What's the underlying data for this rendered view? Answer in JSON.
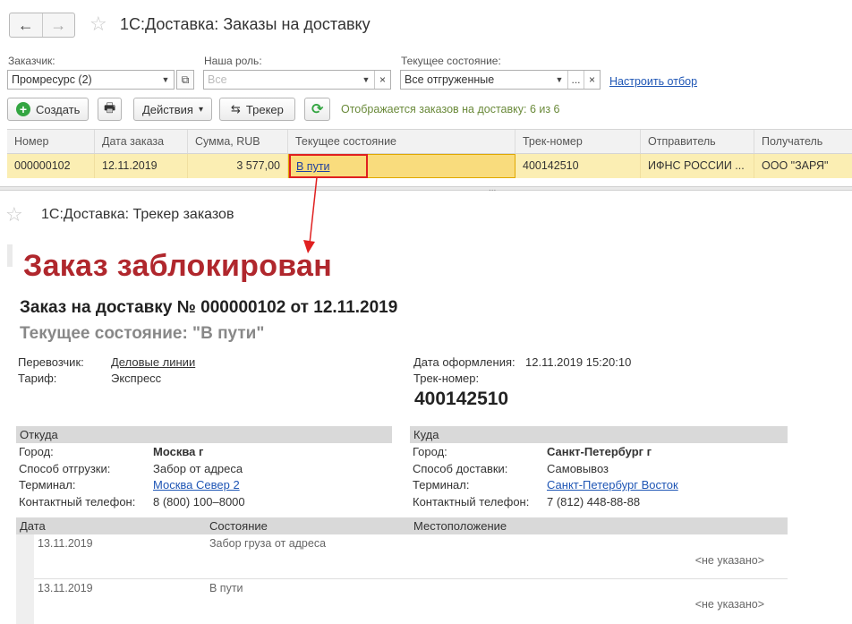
{
  "top_window": {
    "title": "1С:Доставка: Заказы на доставку",
    "nav": {
      "back_icon": "←",
      "forward_icon": "→"
    },
    "star_icon": "☆",
    "filters": {
      "customer": {
        "label": "Заказчик:",
        "value": "Промресурс (2)"
      },
      "role": {
        "label": "Наша роль:",
        "placeholder": "Все"
      },
      "state": {
        "label": "Текущее состояние:",
        "value": "Все отгруженные"
      },
      "dots_label": "...",
      "clear_label": "×",
      "open_icon": "⧉",
      "configure_link": "Настроить отбор"
    },
    "toolbar": {
      "create_label": "Создать",
      "create_icon": "+",
      "print_icon": "🖶",
      "actions_label": "Действия",
      "actions_arrow": "▾",
      "tracker_label": "Трекер",
      "tracker_icon": "⇆",
      "refresh_icon": "⟳",
      "info_text": "Отображается заказов на доставку: 6 из 6"
    },
    "table": {
      "columns": [
        "Номер",
        "Дата заказа",
        "Сумма, RUB",
        "Текущее состояние",
        "Трек-номер",
        "Отправитель",
        "Получатель"
      ],
      "rows": [
        [
          "000000102",
          "12.11.2019",
          "3 577,00",
          "В пути",
          "400142510",
          "ИФНС РОССИИ ...",
          "ООО \"ЗАРЯ\""
        ]
      ]
    },
    "splitter_dots": "..."
  },
  "tracker": {
    "title": "1С:Доставка: Трекер заказов",
    "blocked_text": "Заказ заблокирован",
    "order_heading": "Заказ на доставку № 000000102 от 12.11.2019",
    "state_heading": "Текущее состояние: \"В пути\"",
    "carrier_label": "Перевозчик:",
    "carrier_value": "Деловые линии",
    "tariff_label": "Тариф:",
    "tariff_value": "Экспресс",
    "date_label": "Дата оформления:",
    "date_value": "12.11.2019 15:20:10",
    "track_label": "Трек-номер:",
    "track_value": "400142510",
    "from": {
      "title": "Откуда",
      "city_label": "Город:",
      "city": "Москва г",
      "method_label": "Способ отгрузки:",
      "method": "Забор от адреса",
      "terminal_label": "Терминал:",
      "terminal": "Москва Север 2",
      "phone_label": "Контактный телефон:",
      "phone": "8 (800) 100–8000"
    },
    "to": {
      "title": "Куда",
      "city_label": "Город:",
      "city": "Санкт-Петербург г",
      "method_label": "Способ доставки:",
      "method": "Самовывоз",
      "terminal_label": "Терминал:",
      "terminal": "Санкт-Петербург Восток",
      "phone_label": "Контактный телефон:",
      "phone": "7 (812) 448-88-88"
    },
    "history": {
      "columns": [
        "Дата",
        "Состояние",
        "Местоположение"
      ],
      "rows": [
        {
          "date": "13.11.2019",
          "state": "Забор груза от адреса",
          "location": "<не указано>"
        },
        {
          "date": "13.11.2019",
          "state": "В пути",
          "location": "<не указано>"
        }
      ]
    }
  },
  "colors": {
    "selected_row": "#fbeeb3",
    "highlight_box": "#e02020",
    "blocked_red": "#b0272d",
    "link": "#1f56b5"
  }
}
